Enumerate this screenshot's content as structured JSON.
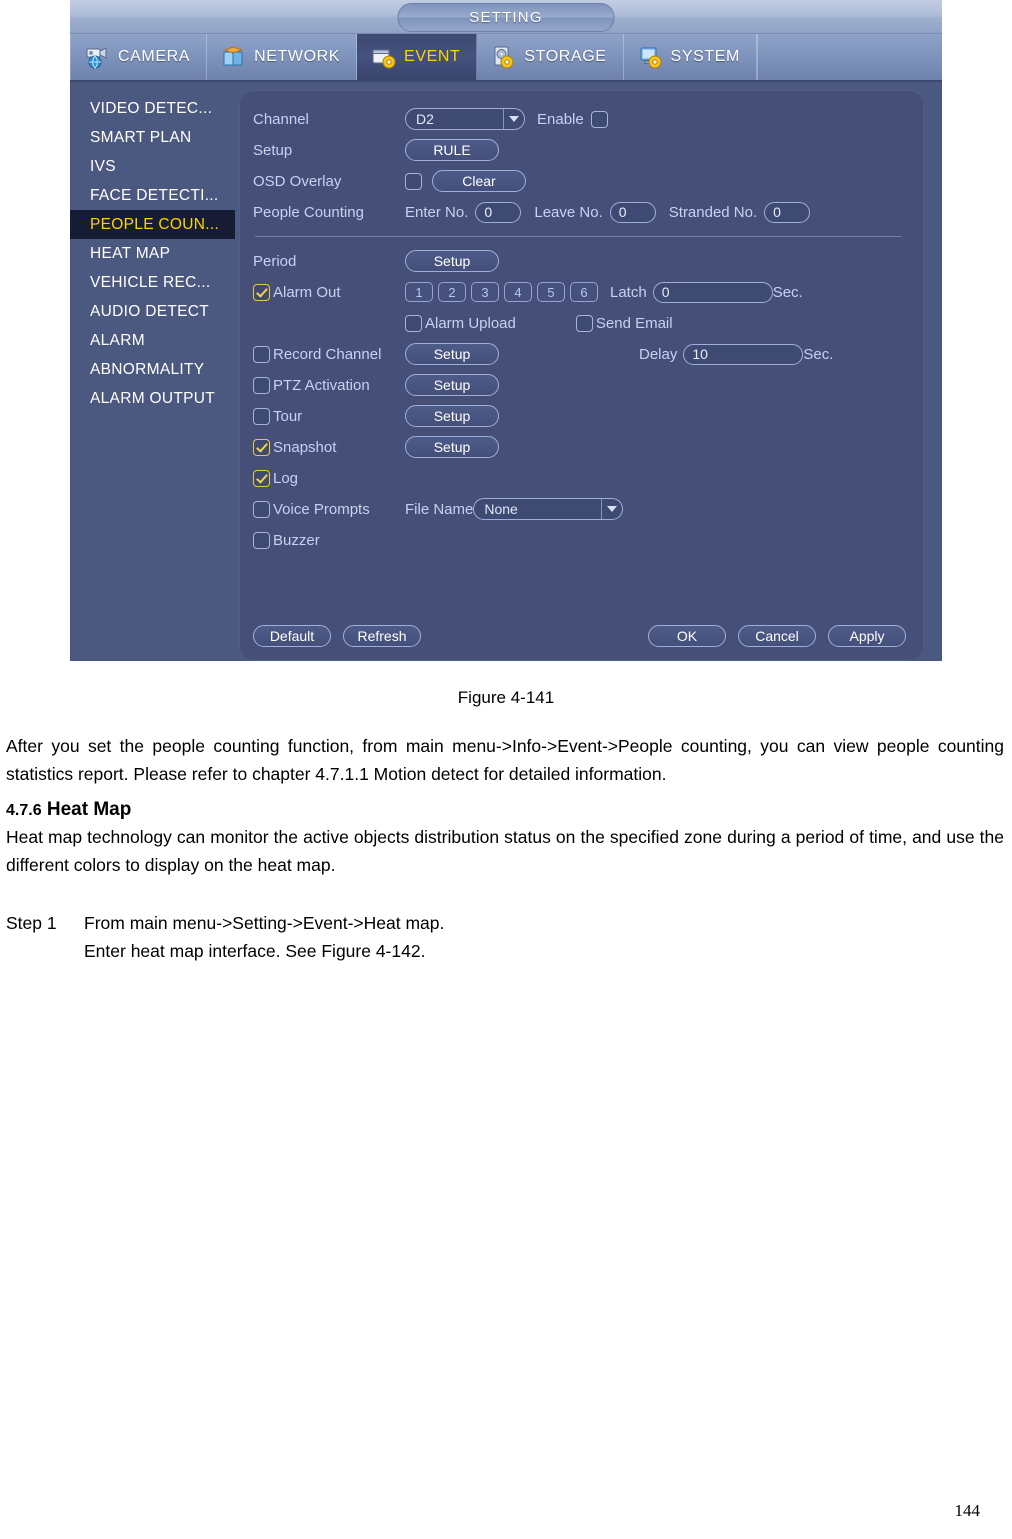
{
  "dialog": {
    "title": "SETTING",
    "tabs": [
      {
        "label": "CAMERA",
        "icon": "camera-icon",
        "active": false
      },
      {
        "label": "NETWORK",
        "icon": "network-icon",
        "active": false
      },
      {
        "label": "EVENT",
        "icon": "event-icon",
        "active": true
      },
      {
        "label": "STORAGE",
        "icon": "storage-icon",
        "active": false
      },
      {
        "label": "SYSTEM",
        "icon": "system-icon",
        "active": false
      }
    ],
    "sidebar": {
      "items": [
        {
          "label": "VIDEO DETEC...",
          "active": false
        },
        {
          "label": "SMART PLAN",
          "active": false
        },
        {
          "label": "IVS",
          "active": false
        },
        {
          "label": "FACE DETECTI...",
          "active": false
        },
        {
          "label": "PEOPLE COUN...",
          "active": true
        },
        {
          "label": "HEAT MAP",
          "active": false
        },
        {
          "label": "VEHICLE REC...",
          "active": false
        },
        {
          "label": "AUDIO DETECT",
          "active": false
        },
        {
          "label": "ALARM",
          "active": false
        },
        {
          "label": "ABNORMALITY",
          "active": false
        },
        {
          "label": "ALARM OUTPUT",
          "active": false
        }
      ]
    },
    "form": {
      "channel_label": "Channel",
      "channel_value": "D2",
      "enable_label": "Enable",
      "enable_checked": false,
      "setup_label": "Setup",
      "rule_button": "RULE",
      "osd_overlay_label": "OSD Overlay",
      "osd_overlay_checked": false,
      "clear_button": "Clear",
      "people_counting_label": "People Counting",
      "enter_no_label": "Enter No.",
      "enter_no_value": "0",
      "leave_no_label": "Leave No.",
      "leave_no_value": "0",
      "stranded_no_label": "Stranded No.",
      "stranded_no_value": "0",
      "period_label": "Period",
      "period_button": "Setup",
      "alarm_out_label": "Alarm Out",
      "alarm_out_checked": true,
      "alarm_out_channels": [
        "1",
        "2",
        "3",
        "4",
        "5",
        "6"
      ],
      "latch_label": "Latch",
      "latch_value": "0",
      "latch_unit": "Sec.",
      "alarm_upload_label": "Alarm Upload",
      "alarm_upload_checked": false,
      "send_email_label": "Send Email",
      "send_email_checked": false,
      "record_channel_label": "Record Channel",
      "record_channel_checked": false,
      "record_channel_button": "Setup",
      "delay_label": "Delay",
      "delay_value": "10",
      "delay_unit": "Sec.",
      "ptz_activation_label": "PTZ Activation",
      "ptz_activation_checked": false,
      "ptz_activation_button": "Setup",
      "tour_label": "Tour",
      "tour_checked": false,
      "tour_button": "Setup",
      "snapshot_label": "Snapshot",
      "snapshot_checked": true,
      "snapshot_button": "Setup",
      "log_label": "Log",
      "log_checked": true,
      "voice_prompts_label": "Voice Prompts",
      "voice_prompts_checked": false,
      "file_name_label": "File Name",
      "file_name_value": "None",
      "buzzer_label": "Buzzer",
      "buzzer_checked": false
    },
    "footer": {
      "default_button": "Default",
      "refresh_button": "Refresh",
      "ok_button": "OK",
      "cancel_button": "Cancel",
      "apply_button": "Apply"
    }
  },
  "document": {
    "figure_caption": "Figure 4-141",
    "paragraph1": "After you set the people counting function, from main menu->Info->Event->People counting, you can view people counting statistics report. Please refer to chapter 4.7.1.1 Motion detect for detailed information.",
    "heading_number": "4.7.6",
    "heading_text": "Heat Map",
    "paragraph2": "Heat map technology can monitor the active objects distribution status on the specified zone during a period of time, and use the different colors to display on the heat map.",
    "step_label": "Step 1",
    "step_text": "From main menu->Setting->Event->Heat map.",
    "step_subtext": "Enter heat map interface. See Figure 4-142.",
    "page_number": "144"
  },
  "colors": {
    "dialog_bg": "#4b5880",
    "panel_bg": "#454f78",
    "accent_yellow": "#ffd400",
    "label_blue": "#c5d2f2",
    "active_item_bg": "#161c33"
  }
}
